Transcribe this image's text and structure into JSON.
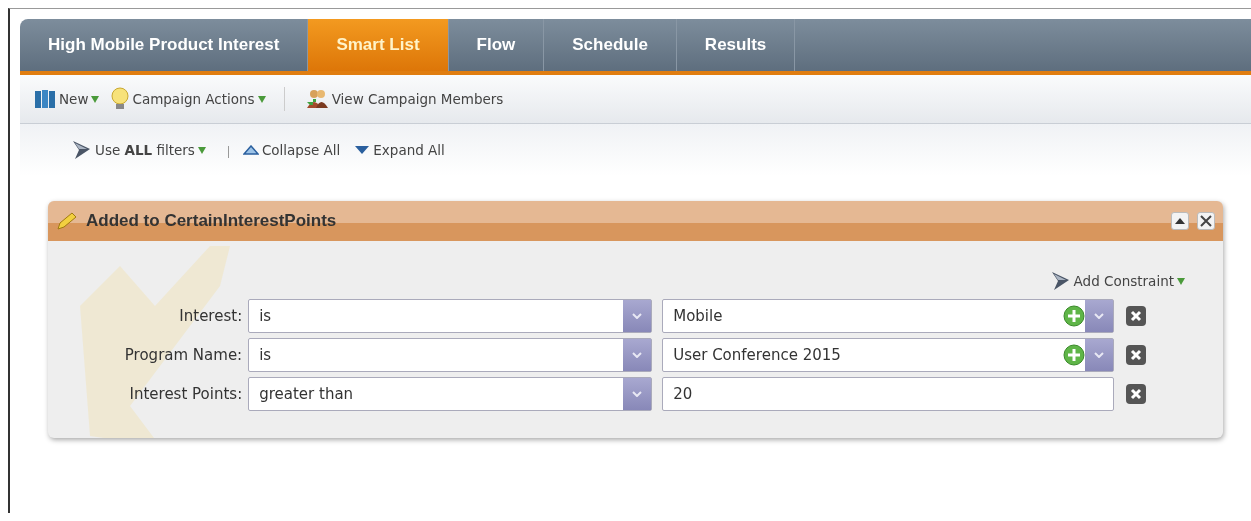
{
  "tabs": [
    {
      "label": "High Mobile Product Interest",
      "selected": false
    },
    {
      "label": "Smart List",
      "selected": true
    },
    {
      "label": "Flow",
      "selected": false
    },
    {
      "label": "Schedule",
      "selected": false
    },
    {
      "label": "Results",
      "selected": false
    }
  ],
  "toolbar": [
    {
      "kind": "new",
      "label": "New",
      "menu": true
    },
    {
      "kind": "actions",
      "label": "Campaign Actions",
      "menu": true
    },
    {
      "kind": "members",
      "label": "View Campaign Members",
      "menu": false
    }
  ],
  "filter_bar": {
    "logic": "Use **ALL** filters",
    "collapse": "Collapse All",
    "expand": "Expand All"
  },
  "filter_card": {
    "title": "Added to CertainInterestPoints",
    "add_constraint": "Add Constraint",
    "constraints": [
      {
        "label": "Interest:",
        "operator": "is",
        "value": "Mobile",
        "kind": "picker"
      },
      {
        "label": "Program Name:",
        "operator": "is",
        "value": "User Conference 2015",
        "kind": "picker"
      },
      {
        "label": "Interest Points:",
        "operator": "greater than",
        "value": "20",
        "kind": "text"
      }
    ]
  }
}
